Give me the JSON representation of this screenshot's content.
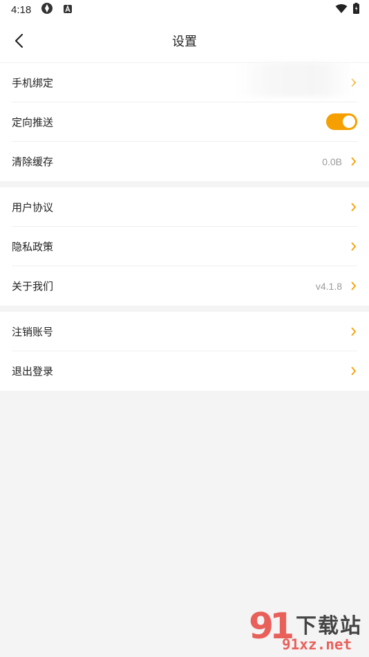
{
  "status_bar": {
    "time": "4:18"
  },
  "header": {
    "title": "设置"
  },
  "groups": [
    {
      "items": [
        {
          "label": "手机绑定",
          "value": ""
        },
        {
          "label": "定向推送",
          "toggle_on": true
        },
        {
          "label": "清除缓存",
          "value": "0.0B"
        }
      ]
    },
    {
      "items": [
        {
          "label": "用户协议",
          "value": ""
        },
        {
          "label": "隐私政策",
          "value": ""
        },
        {
          "label": "关于我们",
          "value": "v4.1.8"
        }
      ]
    },
    {
      "items": [
        {
          "label": "注销账号",
          "value": ""
        },
        {
          "label": "退出登录",
          "value": ""
        }
      ]
    }
  ],
  "watermark": {
    "brand": "下载站",
    "number": "91",
    "url": "91xz.net"
  },
  "colors": {
    "accent": "#f5a000",
    "background": "#f4f4f4"
  }
}
